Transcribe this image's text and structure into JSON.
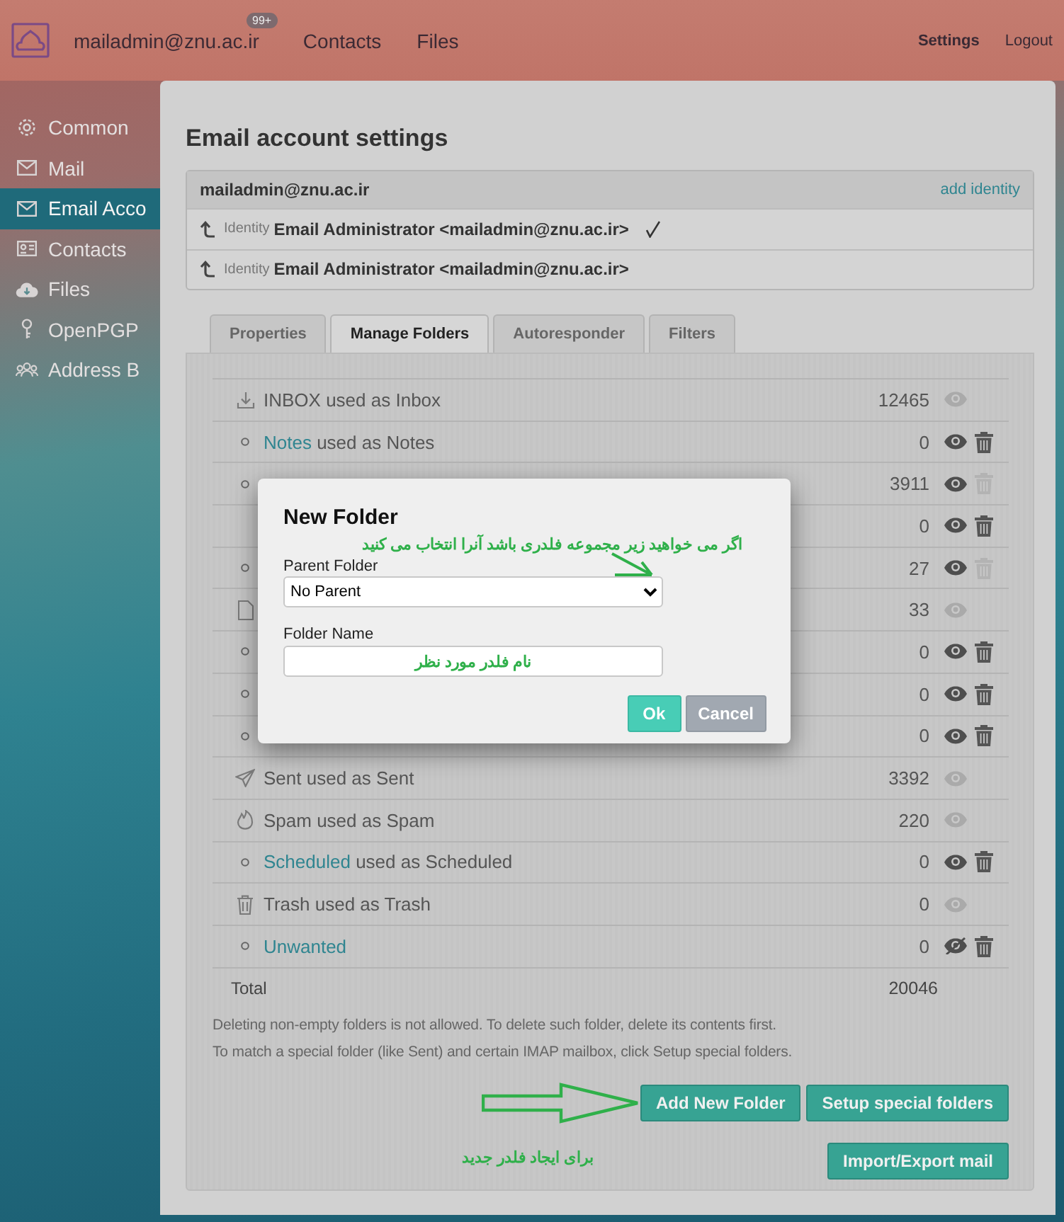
{
  "topbar": {
    "account": "mailadmin@znu.ac.ir",
    "badge": "99+",
    "nav": [
      {
        "label": "Contacts"
      },
      {
        "label": "Files"
      }
    ],
    "right": [
      {
        "label": "Settings",
        "selected": true
      },
      {
        "label": "Logout",
        "selected": false
      }
    ]
  },
  "sidebar": {
    "items": [
      {
        "label": "Common",
        "kind": "gear",
        "selected": false
      },
      {
        "label": "Mail",
        "kind": "mail",
        "selected": false
      },
      {
        "label": "Email Acco",
        "kind": "mail",
        "selected": true
      },
      {
        "label": "Contacts",
        "kind": "card",
        "selected": false
      },
      {
        "label": "Files",
        "kind": "cloud",
        "selected": false
      },
      {
        "label": "OpenPGP",
        "kind": "key",
        "selected": false
      },
      {
        "label": "Address B",
        "kind": "people",
        "selected": false
      }
    ]
  },
  "settings": {
    "title": "Email account settings",
    "account": {
      "email": "mailadmin@znu.ac.ir",
      "action": "add identity"
    },
    "identities": [
      {
        "prefix": "Identity",
        "name": "Email Administrator <mailadmin@znu.ac.ir>",
        "default": true
      },
      {
        "prefix": "Identity",
        "name": "Email Administrator <mailadmin@znu.ac.ir>",
        "default": false
      }
    ],
    "tabs": [
      {
        "label": "Properties",
        "selected": false
      },
      {
        "label": "Manage Folders",
        "selected": true
      },
      {
        "label": "Autoresponder",
        "selected": false
      },
      {
        "label": "Filters",
        "selected": false
      }
    ],
    "folders": [
      {
        "kind": "download",
        "name": "INBOX",
        "link": false,
        "role": "used as Inbox",
        "count": "12465",
        "toggle_enabled": false,
        "hidden": false,
        "deletable": false
      },
      {
        "kind": "circle",
        "name": "Notes",
        "link": true,
        "role": "used as Notes",
        "count": "0",
        "toggle_enabled": true,
        "hidden": false,
        "deletable": true,
        "delete_enabled": true
      },
      {
        "kind": "circle",
        "count": "3911",
        "toggle_enabled": true,
        "hidden": false,
        "deletable": true,
        "delete_enabled": false
      },
      {
        "kind": "none",
        "count": "0",
        "toggle_enabled": true,
        "hidden": false,
        "deletable": true,
        "delete_enabled": true
      },
      {
        "kind": "circle",
        "count": "27",
        "toggle_enabled": true,
        "hidden": false,
        "deletable": true,
        "delete_enabled": false
      },
      {
        "kind": "file",
        "count": "33",
        "toggle_enabled": false,
        "hidden": false,
        "deletable": false
      },
      {
        "kind": "circle",
        "count": "0",
        "toggle_enabled": true,
        "hidden": false,
        "deletable": true,
        "delete_enabled": true
      },
      {
        "kind": "circle",
        "count": "0",
        "toggle_enabled": true,
        "hidden": false,
        "deletable": true,
        "delete_enabled": true
      },
      {
        "kind": "circle",
        "count": "0",
        "toggle_enabled": true,
        "hidden": false,
        "deletable": true,
        "delete_enabled": true
      },
      {
        "kind": "send",
        "name": "Sent",
        "link": false,
        "role": "used as Sent",
        "count": "3392",
        "toggle_enabled": false,
        "hidden": false,
        "deletable": false
      },
      {
        "kind": "fire",
        "name": "Spam",
        "link": false,
        "role": "used as Spam",
        "count": "220",
        "toggle_enabled": false,
        "hidden": false,
        "deletable": false
      },
      {
        "kind": "circle",
        "name": "Scheduled",
        "link": true,
        "role": "used as Scheduled",
        "count": "0",
        "toggle_enabled": true,
        "hidden": false,
        "deletable": true,
        "delete_enabled": true
      },
      {
        "kind": "trash",
        "name": "Trash",
        "link": false,
        "role": "used as Trash",
        "count": "0",
        "toggle_enabled": false,
        "hidden": false,
        "deletable": false
      },
      {
        "kind": "circle",
        "name": "Unwanted",
        "link": true,
        "count": "0",
        "toggle_enabled": true,
        "hidden": true,
        "deletable": true,
        "delete_enabled": true
      }
    ],
    "total": {
      "label": "Total",
      "count": "20046"
    },
    "notes": [
      "Deleting non-empty folders is not allowed. To delete such folder, delete its contents first.",
      "To match a special folder (like Sent) and certain IMAP mailbox, click Setup special folders."
    ],
    "buttons": [
      {
        "label": "Add New Folder"
      },
      {
        "label": "Setup special folders"
      },
      {
        "label": "Import/Export mail"
      }
    ],
    "annotation": "برای ایجاد فلدر جدید"
  },
  "dialog": {
    "title": "New Folder",
    "annotation": "اگر می خواهید زیر مجموعه فلدری باشد آنرا انتخاب می کنید",
    "parent_label": "Parent Folder",
    "parent_value": "No Parent",
    "name_label": "Folder Name",
    "name_annotation": "نام فلدر مورد نظر",
    "buttons": [
      {
        "label": "Ok",
        "kind": "primary"
      },
      {
        "label": "Cancel",
        "kind": "secondary"
      }
    ]
  }
}
